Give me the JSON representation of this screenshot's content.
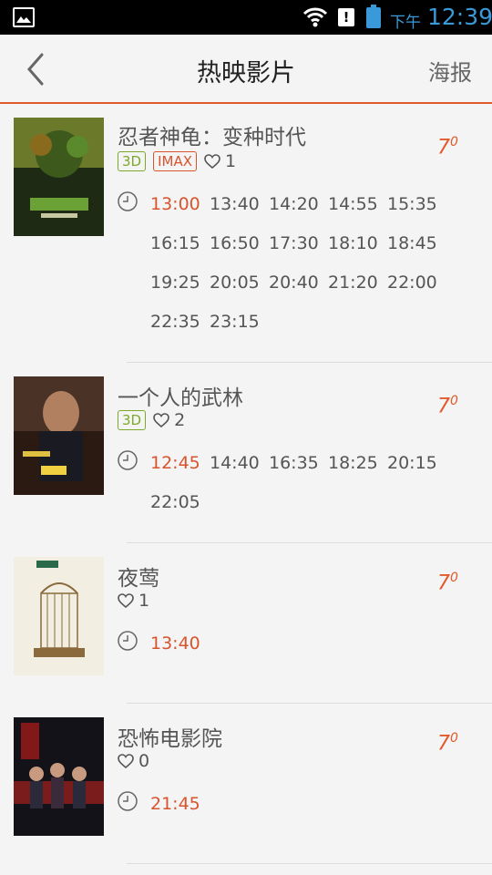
{
  "status": {
    "time_label": "下午",
    "time": "12:39",
    "alert": "!"
  },
  "header": {
    "title": "热映影片",
    "right_label": "海报"
  },
  "movies": [
    {
      "title": "忍者神龟：变种时代",
      "rating": "7",
      "rating_decimal": "0",
      "tags": [
        "3D",
        "IMAX"
      ],
      "likes": "1",
      "showtimes": [
        "13:00",
        "13:40",
        "14:20",
        "14:55",
        "15:35",
        "16:15",
        "16:50",
        "17:30",
        "18:10",
        "18:45",
        "19:25",
        "20:05",
        "20:40",
        "21:20",
        "22:00",
        "22:35",
        "23:15"
      ]
    },
    {
      "title": "一个人的武林",
      "rating": "7",
      "rating_decimal": "0",
      "tags": [
        "3D"
      ],
      "likes": "2",
      "showtimes": [
        "12:45",
        "14:40",
        "16:35",
        "18:25",
        "20:15",
        "22:05"
      ]
    },
    {
      "title": "夜莺",
      "rating": "7",
      "rating_decimal": "0",
      "tags": [],
      "likes": "1",
      "showtimes": [
        "13:40"
      ]
    },
    {
      "title": "恐怖电影院",
      "rating": "7",
      "rating_decimal": "0",
      "tags": [],
      "likes": "0",
      "showtimes": [
        "21:45"
      ]
    }
  ],
  "colors": {
    "accent": "#e15a2c",
    "tag3d": "#7da92b",
    "status_blue": "#3a9ad9"
  }
}
